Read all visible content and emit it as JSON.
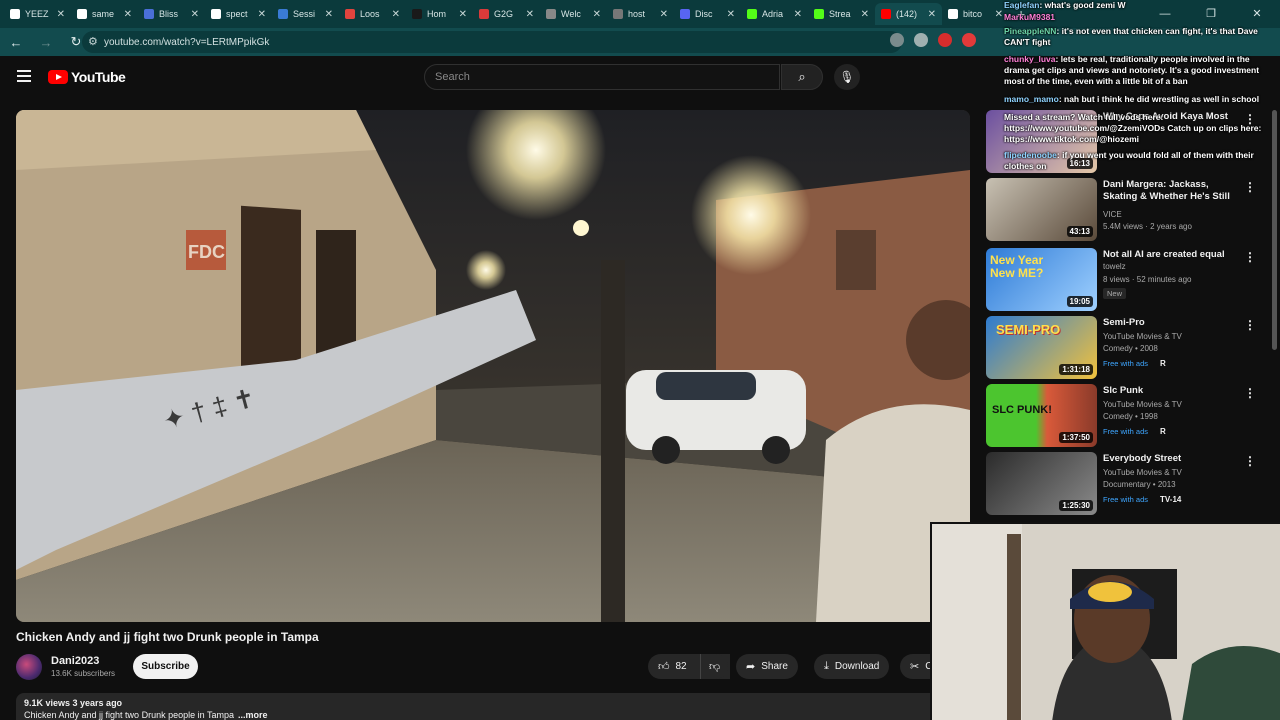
{
  "browser": {
    "tabs": [
      {
        "label": "YEEZ",
        "color": "#ffffff"
      },
      {
        "label": "same",
        "color": "#ffffff"
      },
      {
        "label": "Bliss",
        "color": "#4a6fd8"
      },
      {
        "label": "spect",
        "color": "#ffffff"
      },
      {
        "label": "Sessi",
        "color": "#3a7bd5"
      },
      {
        "label": "Loos",
        "color": "#e0443e"
      },
      {
        "label": "Hom",
        "color": "#1a1a1a"
      },
      {
        "label": "G2G",
        "color": "#d93a3a"
      },
      {
        "label": "Welc",
        "color": "#888888"
      },
      {
        "label": "host",
        "color": "#777777"
      },
      {
        "label": "Disc",
        "color": "#5865f2"
      },
      {
        "label": "Adria",
        "color": "#53fc18"
      },
      {
        "label": "Strea",
        "color": "#53fc18"
      },
      {
        "label": "(142)",
        "color": "#ff0000"
      },
      {
        "label": "bitco",
        "color": "#ffffff"
      }
    ],
    "url": "youtube.com/watch?v=LERtMPpikGk"
  },
  "youtube": {
    "logo_text": "YouTube",
    "search_placeholder": "Search"
  },
  "video": {
    "title": "Chicken Andy and jj fight two Drunk people in Tampa",
    "channel": "Dani2023",
    "subscribers": "13.6K subscribers",
    "subscribe_label": "Subscribe",
    "likes": "82",
    "share_label": "Share",
    "download_label": "Download",
    "clip_label": "Clip",
    "views_meta": "9.1K views  3 years ago",
    "description": "Chicken Andy and jj fight two Drunk people in Tampa",
    "more_label": "...more",
    "scene_sign": "FDC"
  },
  "sidebar": {
    "recommendations": [
      {
        "title": "Why Cops Avoid Kaya Most",
        "channel": "",
        "meta": "",
        "duration": "16:13",
        "thumb": [
          "#6b4fa0",
          "#e6c9a8"
        ],
        "badge": "",
        "rating": ""
      },
      {
        "title": "Dani Margera: Jackass, Skating & Whether He's Still Epicl...",
        "channel": "VICE",
        "meta": "5.4M views · 2 years ago",
        "duration": "43:13",
        "thumb": [
          "#c8c1b3",
          "#5a4a3a"
        ],
        "badge": "",
        "rating": ""
      },
      {
        "title": "Not all AI are created equal",
        "channel": "towelz",
        "meta": "8 views · 52 minutes ago",
        "duration": "19:05",
        "thumb": [
          "#2e7bd6",
          "#ffe14d"
        ],
        "badge": "New",
        "rating": ""
      },
      {
        "title": "Semi-Pro",
        "channel": "YouTube Movies & TV",
        "meta": "Comedy • 2008",
        "duration": "1:31:18",
        "thumb": [
          "#2d7bd1",
          "#f2c23c"
        ],
        "badge": "Free with ads",
        "rating": "R"
      },
      {
        "title": "Slc Punk",
        "channel": "YouTube Movies & TV",
        "meta": "Comedy • 1998",
        "duration": "1:37:50",
        "thumb": [
          "#4cc52f",
          "#d95a3a"
        ],
        "badge": "Free with ads",
        "rating": "R"
      },
      {
        "title": "Everybody Street",
        "channel": "YouTube Movies & TV",
        "meta": "Documentary • 2013",
        "duration": "1:25:30",
        "thumb": [
          "#2b2b2b",
          "#8a8a8a"
        ],
        "badge": "Free with ads",
        "rating": "TV-14"
      }
    ],
    "thumb_texts": {
      "rec2": "New Year New ME?",
      "rec3": "SEMI-PRO",
      "rec4": "SLC PUNK!"
    }
  },
  "chat": [
    {
      "user": "Eaglefan",
      "text": ": what's good zemi W",
      "cls": "u1"
    },
    {
      "user": "MarkuM9381",
      "text": "",
      "cls": "u2"
    },
    {
      "user": "PineappleNN",
      "text": ": it's not even that chicken can fight, it's that Dave CAN'T fight",
      "cls": "u3"
    },
    {
      "user": "chunky_luva",
      "text": ": lets be real, traditionally people involved in the drama get clips and views and notoriety. It's a good investment most of the time, even with a little bit of a ban",
      "cls": "u2"
    },
    {
      "user": "mamo_mamo",
      "text": ": nah but i think he did wrestling as well in school",
      "cls": "u1"
    },
    {
      "user": "",
      "text": "Missed a stream? Watch full vods here: https://www.youtube.com/@ZzemiVODs Catch up on clips here: https://www.tiktok.com/@hiozemi",
      "cls": "u3"
    },
    {
      "user": "flipedenoobe",
      "text": ": if you went you would fold all of them with their clothes on",
      "cls": "u1"
    },
    {
      "user": "mamo_mamo",
      "text": ": yeah dave is all talk",
      "cls": "u1"
    },
    {
      "user": "chunky_luva",
      "text": ": in the clubhouse",
      "cls": "u2"
    }
  ],
  "colors": {
    "browser_tabbar": "#0b3a3c",
    "browser_toolbar": "#124b4e",
    "youtube_red": "#ff0000",
    "background": "#0f0f0f",
    "link_blue": "#3ea6ff"
  }
}
